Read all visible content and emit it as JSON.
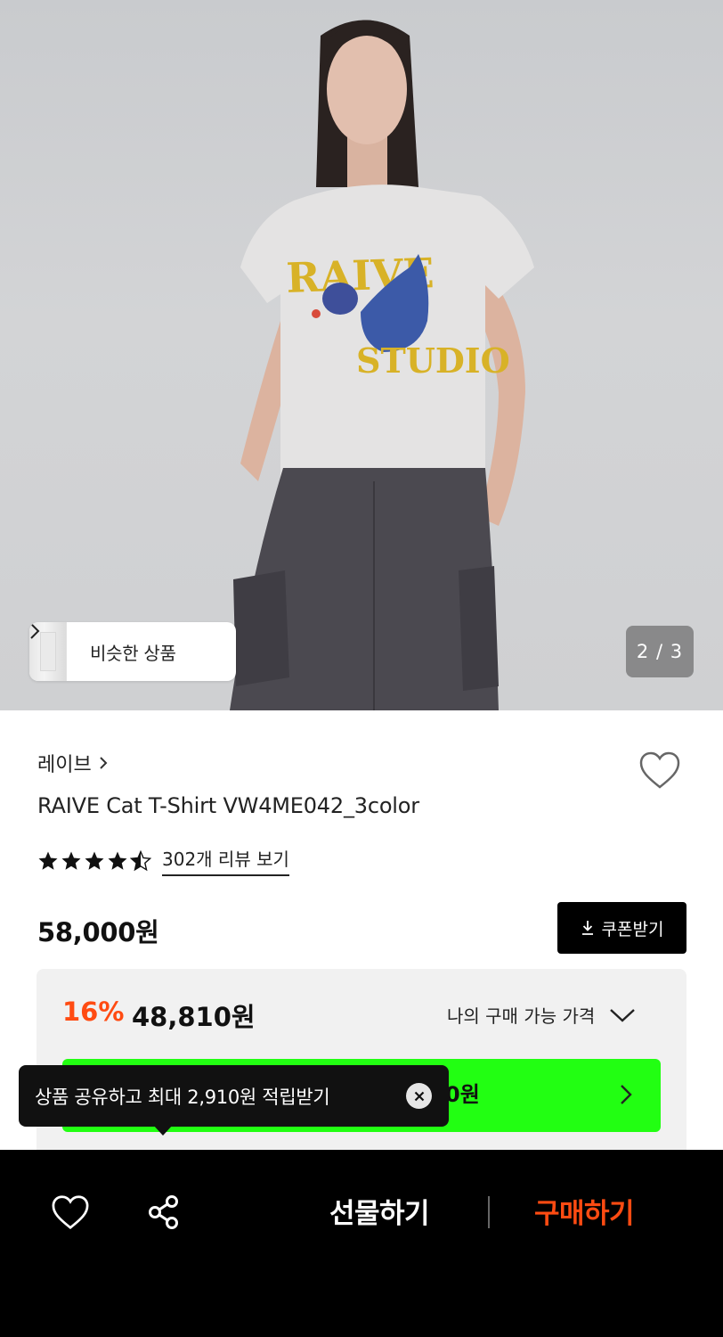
{
  "gallery": {
    "similar_label": "비슷한 상품",
    "page_indicator": "2 / 3"
  },
  "product": {
    "brand": "레이브",
    "title": "RAIVE Cat T-Shirt VW4ME042_3color",
    "rating": 4.5,
    "review_link": "302개 리뷰 보기",
    "price": "58,000원",
    "coupon_label": "쿠폰받기"
  },
  "pricing": {
    "discount_rate": "16%",
    "discount_price": "48,810원",
    "my_price_label": "나의 구매 가능 가격",
    "green_button_partial": "0원"
  },
  "tooltip": {
    "text": "상품 공유하고 최대 2,910원 적립받기"
  },
  "bottom_bar": {
    "gift_label": "선물하기",
    "buy_label": "구매하기"
  },
  "colors": {
    "accent": "#ff4b12",
    "green": "#22ff12",
    "dark": "#000000"
  },
  "icons": [
    "chevron-right-icon",
    "heart-icon",
    "star-icon",
    "download-icon",
    "chevron-down-icon",
    "close-icon",
    "share-icon"
  ]
}
